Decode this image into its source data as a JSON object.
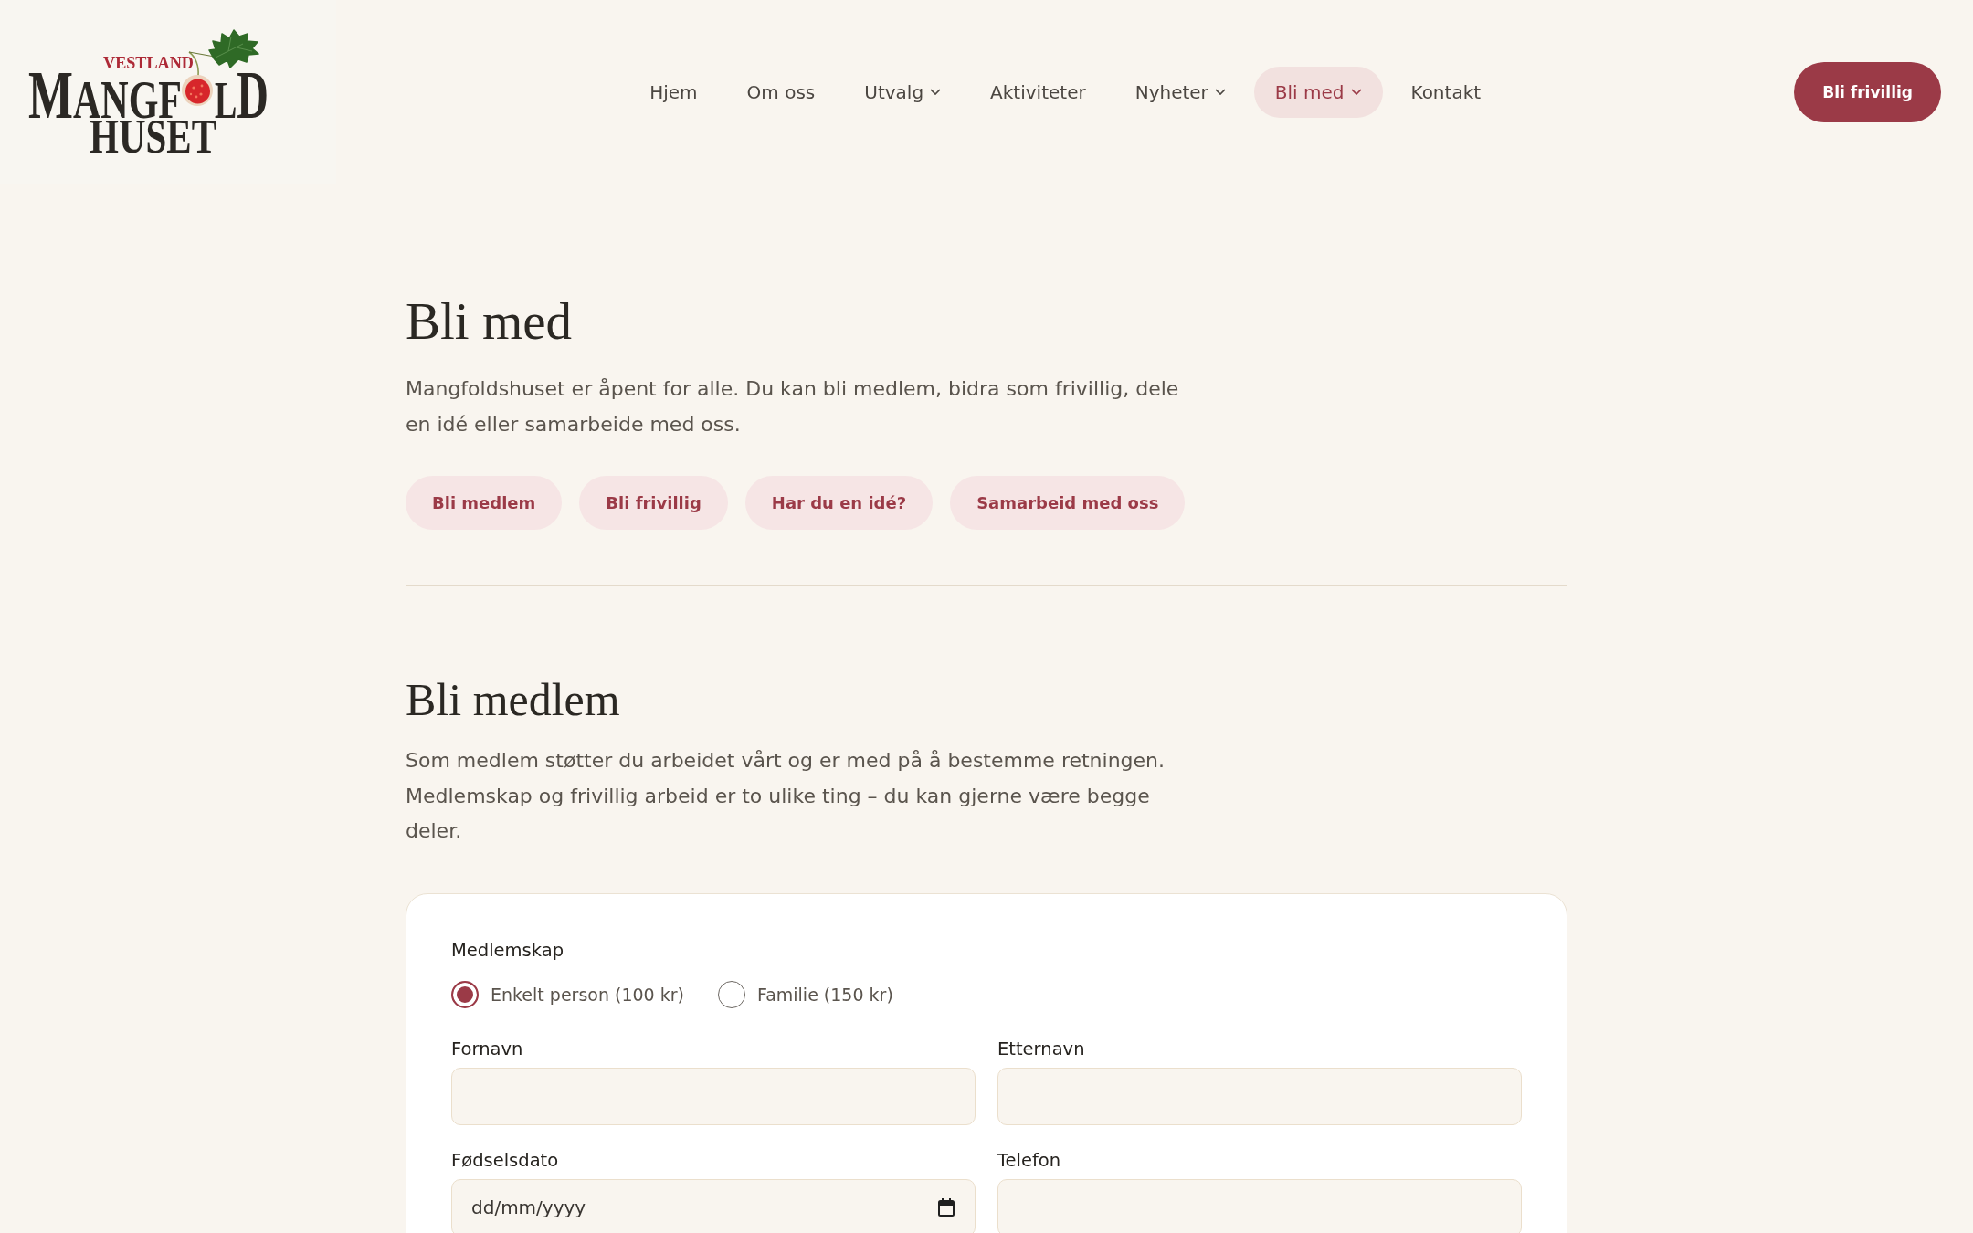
{
  "header": {
    "logo": {
      "tagline": "VESTLAND",
      "name_start": "MANGF",
      "name_end": "LD",
      "name_bottom": "HUSET"
    },
    "nav": [
      {
        "label": "Hjem",
        "dropdown": false,
        "selected": false
      },
      {
        "label": "Om oss",
        "dropdown": false,
        "selected": false
      },
      {
        "label": "Utvalg",
        "dropdown": true,
        "selected": false
      },
      {
        "label": "Aktiviteter",
        "dropdown": false,
        "selected": false
      },
      {
        "label": "Nyheter",
        "dropdown": true,
        "selected": false
      },
      {
        "label": "Bli med",
        "dropdown": true,
        "selected": true
      },
      {
        "label": "Kontakt",
        "dropdown": false,
        "selected": false
      }
    ],
    "cta_button": "Bli frivillig"
  },
  "intro": {
    "title": "Bli med",
    "text": "Mangfoldshuset er åpent for alle. Du kan bli medlem, bidra som frivillig, dele en idé eller samarbeide med oss.",
    "links": [
      "Bli medlem",
      "Bli frivillig",
      "Har du en idé?",
      "Samarbeid med oss"
    ]
  },
  "membership": {
    "title": "Bli medlem",
    "text": "Som medlem støtter du arbeidet vårt og er med på å bestemme retningen. Medlemskap og frivillig arbeid er to ulike ting – du kan gjerne være begge deler.",
    "form": {
      "group_label": "Medlemskap",
      "options": [
        {
          "label": "Enkelt person (100 kr)",
          "selected": true
        },
        {
          "label": "Familie (150 kr)",
          "selected": false
        }
      ],
      "fields": [
        {
          "label": "Fornavn",
          "kind": "text"
        },
        {
          "label": "Etternavn",
          "kind": "text"
        },
        {
          "label": "Fødselsdato",
          "kind": "date",
          "placeholder": "dd/mm/yyyy"
        },
        {
          "label": "Telefon",
          "kind": "text"
        }
      ]
    }
  }
}
